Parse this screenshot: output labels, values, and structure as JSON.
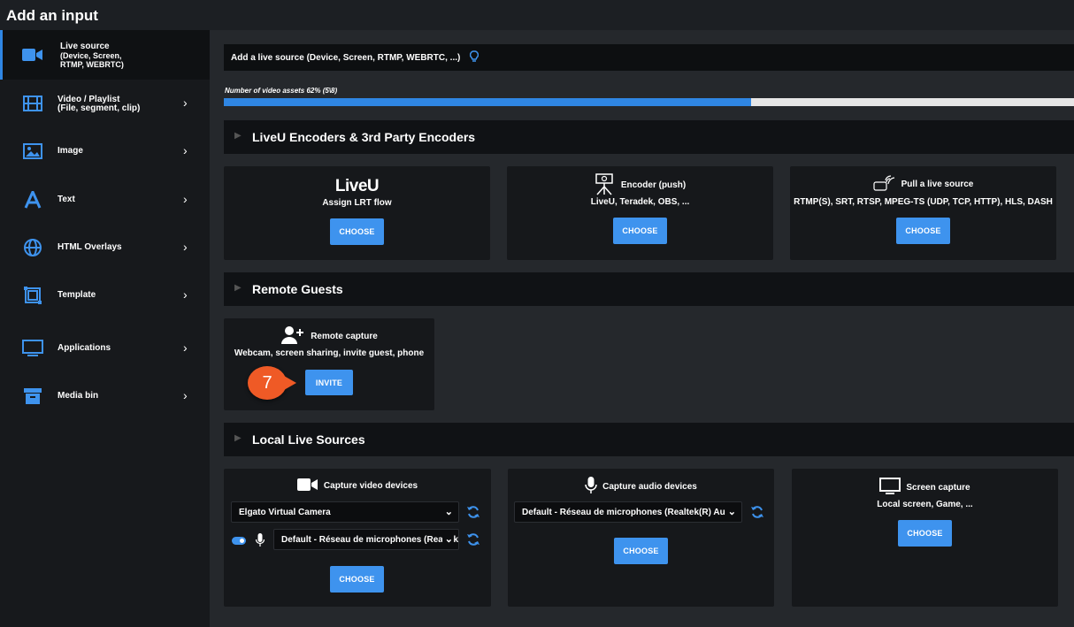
{
  "window": {
    "title": "Add an input"
  },
  "sidebar": {
    "items": [
      {
        "label_lines": [
          "Live source",
          "(Device, Screen,",
          "RTMP, WEBRTC)"
        ],
        "icon": "camera-icon",
        "active": true
      },
      {
        "label_lines": [
          "Video / Playlist",
          "(File, segment, clip)"
        ],
        "icon": "film-icon",
        "chevron": "›"
      },
      {
        "label_lines": [
          "Image"
        ],
        "icon": "image-icon",
        "chevron": "›"
      },
      {
        "label_lines": [
          "Text"
        ],
        "icon": "text-icon",
        "chevron": "›"
      },
      {
        "label_lines": [
          "HTML Overlays"
        ],
        "icon": "globe-icon",
        "chevron": "›"
      },
      {
        "label_lines": [
          "Template"
        ],
        "icon": "template-icon",
        "chevron": "›"
      },
      {
        "label_lines": [
          "Applications"
        ],
        "icon": "monitor-icon",
        "chevron": "›"
      },
      {
        "label_lines": [
          "Media bin"
        ],
        "icon": "archive-icon",
        "chevron": "›"
      }
    ]
  },
  "main": {
    "info_text": "Add a live source (Device, Screen, RTMP, WEBRTC, ...)",
    "assets_label": "Number of video assets 62% (5\\8)",
    "assets_progress": 0.62,
    "sections": [
      {
        "title": "LiveU Encoders & 3rd Party Encoders",
        "arrow": "▶"
      },
      {
        "title": "Remote Guests",
        "arrow": "▶"
      },
      {
        "title": "Local Live Sources",
        "arrow": "▶"
      }
    ],
    "encoders": [
      {
        "logo": "LiveU",
        "subtitle": "Assign LRT flow",
        "button": "CHOOSE"
      },
      {
        "title": "Encoder (push)",
        "subtitle": "LiveU, Teradek, OBS, ...",
        "button": "CHOOSE",
        "icon": "tripod-camera-icon"
      },
      {
        "title": "Pull a live source",
        "subtitle": "RTMP(S), SRT, RTSP, MPEG-TS (UDP, TCP, HTTP), HLS, DASH",
        "button": "CHOOSE",
        "icon": "live-antenna-icon"
      }
    ],
    "remote": {
      "title": "Remote capture",
      "subtitle": "Webcam, screen sharing, invite guest, phone",
      "button": "INVITE",
      "badge": "7"
    },
    "local": {
      "video": {
        "title": "Capture video devices",
        "device": "Elgato Virtual Camera",
        "mic": "Default - Réseau de microphones (Realtek(R) Au",
        "button": "CHOOSE"
      },
      "audio": {
        "title": "Capture audio devices",
        "device": "Default - Réseau de microphones (Realtek(R) Au",
        "button": "CHOOSE"
      },
      "screen": {
        "title": "Screen capture",
        "subtitle": "Local screen, Game, ...",
        "button": "CHOOSE"
      }
    }
  },
  "colors": {
    "accent": "#3e93ee",
    "badge": "#ef5a26",
    "sidebar": "#17191c",
    "background": "#25282c"
  }
}
